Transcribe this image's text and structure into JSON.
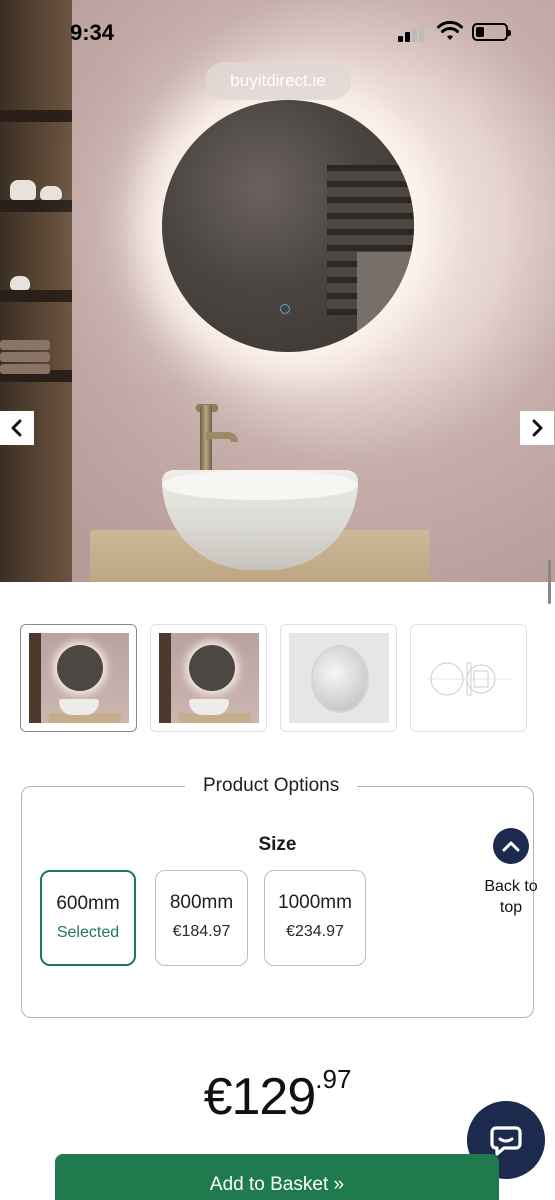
{
  "status_bar": {
    "time": "9:34"
  },
  "browser": {
    "url": "buyitdirect.ie"
  },
  "gallery": {
    "prev_icon": "chevron-left-icon",
    "next_icon": "chevron-right-icon",
    "thumbnails": [
      "lifestyle-front",
      "lifestyle-side",
      "product-plain",
      "technical-drawing"
    ],
    "active_index": 0
  },
  "product_options": {
    "legend": "Product Options",
    "size_label": "Size",
    "sizes": [
      {
        "label": "600mm",
        "price": "Selected"
      },
      {
        "label": "800mm",
        "price": "€184.97"
      },
      {
        "label": "1000mm",
        "price": "€234.97"
      }
    ]
  },
  "back_to_top": {
    "line1": "Back to",
    "line2": "top"
  },
  "price": {
    "main": "€129",
    "cents": ".97"
  },
  "add_to_basket": "Add to Basket »",
  "colors": {
    "primary_green": "#1f7a4d",
    "navy": "#1b2a4d",
    "selected_green": "#1e7a55"
  }
}
